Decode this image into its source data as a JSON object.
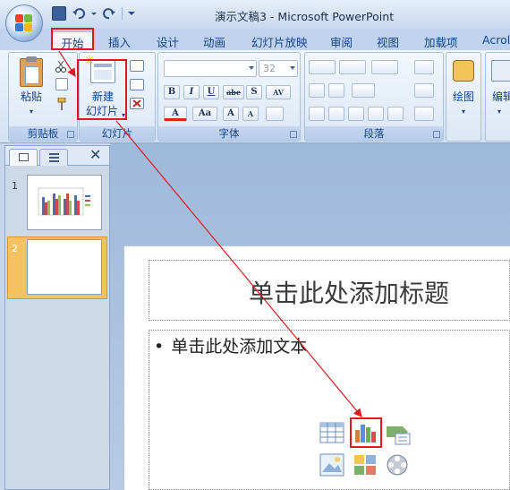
{
  "window": {
    "title": "演示文稿3 - Microsoft PowerPoint"
  },
  "tabs": [
    {
      "label": "开始",
      "active": true
    },
    {
      "label": "插入"
    },
    {
      "label": "设计"
    },
    {
      "label": "动画"
    },
    {
      "label": "幻灯片放映"
    },
    {
      "label": "审阅"
    },
    {
      "label": "视图"
    },
    {
      "label": "加载项"
    },
    {
      "label": "Acrol"
    }
  ],
  "ribbon": {
    "clipboard": {
      "group_label": "剪贴板",
      "paste_label": "粘贴"
    },
    "slides": {
      "group_label": "幻灯片",
      "new_slide_line1": "新建",
      "new_slide_line2": "幻灯片"
    },
    "font": {
      "group_label": "字体",
      "font_size_value": "32",
      "bold": "B",
      "italic": "I",
      "underline": "U",
      "strike": "abe",
      "shadow": "S",
      "spacing": "AV",
      "color": "A",
      "change_case": "Aa",
      "grow": "A",
      "shrink": "A"
    },
    "paragraph": {
      "group_label": "段落"
    },
    "drawing": {
      "label": "绘图"
    },
    "editing": {
      "label": "编辑"
    }
  },
  "slides_pane": {
    "close_glyph": "✕",
    "thumbnails": [
      {
        "number": "1"
      },
      {
        "number": "2",
        "selected": true
      }
    ]
  },
  "slide": {
    "title_placeholder": "单击此处添加标题",
    "body_placeholder": "单击此处添加文本",
    "bullet": "•"
  },
  "content_icons": [
    "insert-table-icon",
    "insert-chart-icon",
    "insert-smartart-icon",
    "insert-picture-icon",
    "insert-clipart-icon",
    "insert-media-icon"
  ],
  "colors": {
    "annotation_red": "#e0191f",
    "ribbon_text": "#15428b",
    "selected_thumb": "#f6c15f"
  }
}
